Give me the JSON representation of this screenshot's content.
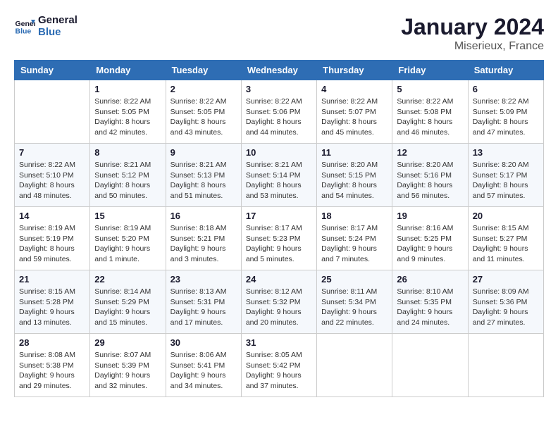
{
  "header": {
    "logo_line1": "General",
    "logo_line2": "Blue",
    "month": "January 2024",
    "location": "Miserieux, France"
  },
  "weekdays": [
    "Sunday",
    "Monday",
    "Tuesday",
    "Wednesday",
    "Thursday",
    "Friday",
    "Saturday"
  ],
  "weeks": [
    [
      {
        "day": "",
        "info": ""
      },
      {
        "day": "1",
        "info": "Sunrise: 8:22 AM\nSunset: 5:05 PM\nDaylight: 8 hours\nand 42 minutes."
      },
      {
        "day": "2",
        "info": "Sunrise: 8:22 AM\nSunset: 5:05 PM\nDaylight: 8 hours\nand 43 minutes."
      },
      {
        "day": "3",
        "info": "Sunrise: 8:22 AM\nSunset: 5:06 PM\nDaylight: 8 hours\nand 44 minutes."
      },
      {
        "day": "4",
        "info": "Sunrise: 8:22 AM\nSunset: 5:07 PM\nDaylight: 8 hours\nand 45 minutes."
      },
      {
        "day": "5",
        "info": "Sunrise: 8:22 AM\nSunset: 5:08 PM\nDaylight: 8 hours\nand 46 minutes."
      },
      {
        "day": "6",
        "info": "Sunrise: 8:22 AM\nSunset: 5:09 PM\nDaylight: 8 hours\nand 47 minutes."
      }
    ],
    [
      {
        "day": "7",
        "info": "Sunrise: 8:22 AM\nSunset: 5:10 PM\nDaylight: 8 hours\nand 48 minutes."
      },
      {
        "day": "8",
        "info": "Sunrise: 8:21 AM\nSunset: 5:12 PM\nDaylight: 8 hours\nand 50 minutes."
      },
      {
        "day": "9",
        "info": "Sunrise: 8:21 AM\nSunset: 5:13 PM\nDaylight: 8 hours\nand 51 minutes."
      },
      {
        "day": "10",
        "info": "Sunrise: 8:21 AM\nSunset: 5:14 PM\nDaylight: 8 hours\nand 53 minutes."
      },
      {
        "day": "11",
        "info": "Sunrise: 8:20 AM\nSunset: 5:15 PM\nDaylight: 8 hours\nand 54 minutes."
      },
      {
        "day": "12",
        "info": "Sunrise: 8:20 AM\nSunset: 5:16 PM\nDaylight: 8 hours\nand 56 minutes."
      },
      {
        "day": "13",
        "info": "Sunrise: 8:20 AM\nSunset: 5:17 PM\nDaylight: 8 hours\nand 57 minutes."
      }
    ],
    [
      {
        "day": "14",
        "info": "Sunrise: 8:19 AM\nSunset: 5:19 PM\nDaylight: 8 hours\nand 59 minutes."
      },
      {
        "day": "15",
        "info": "Sunrise: 8:19 AM\nSunset: 5:20 PM\nDaylight: 9 hours\nand 1 minute."
      },
      {
        "day": "16",
        "info": "Sunrise: 8:18 AM\nSunset: 5:21 PM\nDaylight: 9 hours\nand 3 minutes."
      },
      {
        "day": "17",
        "info": "Sunrise: 8:17 AM\nSunset: 5:23 PM\nDaylight: 9 hours\nand 5 minutes."
      },
      {
        "day": "18",
        "info": "Sunrise: 8:17 AM\nSunset: 5:24 PM\nDaylight: 9 hours\nand 7 minutes."
      },
      {
        "day": "19",
        "info": "Sunrise: 8:16 AM\nSunset: 5:25 PM\nDaylight: 9 hours\nand 9 minutes."
      },
      {
        "day": "20",
        "info": "Sunrise: 8:15 AM\nSunset: 5:27 PM\nDaylight: 9 hours\nand 11 minutes."
      }
    ],
    [
      {
        "day": "21",
        "info": "Sunrise: 8:15 AM\nSunset: 5:28 PM\nDaylight: 9 hours\nand 13 minutes."
      },
      {
        "day": "22",
        "info": "Sunrise: 8:14 AM\nSunset: 5:29 PM\nDaylight: 9 hours\nand 15 minutes."
      },
      {
        "day": "23",
        "info": "Sunrise: 8:13 AM\nSunset: 5:31 PM\nDaylight: 9 hours\nand 17 minutes."
      },
      {
        "day": "24",
        "info": "Sunrise: 8:12 AM\nSunset: 5:32 PM\nDaylight: 9 hours\nand 20 minutes."
      },
      {
        "day": "25",
        "info": "Sunrise: 8:11 AM\nSunset: 5:34 PM\nDaylight: 9 hours\nand 22 minutes."
      },
      {
        "day": "26",
        "info": "Sunrise: 8:10 AM\nSunset: 5:35 PM\nDaylight: 9 hours\nand 24 minutes."
      },
      {
        "day": "27",
        "info": "Sunrise: 8:09 AM\nSunset: 5:36 PM\nDaylight: 9 hours\nand 27 minutes."
      }
    ],
    [
      {
        "day": "28",
        "info": "Sunrise: 8:08 AM\nSunset: 5:38 PM\nDaylight: 9 hours\nand 29 minutes."
      },
      {
        "day": "29",
        "info": "Sunrise: 8:07 AM\nSunset: 5:39 PM\nDaylight: 9 hours\nand 32 minutes."
      },
      {
        "day": "30",
        "info": "Sunrise: 8:06 AM\nSunset: 5:41 PM\nDaylight: 9 hours\nand 34 minutes."
      },
      {
        "day": "31",
        "info": "Sunrise: 8:05 AM\nSunset: 5:42 PM\nDaylight: 9 hours\nand 37 minutes."
      },
      {
        "day": "",
        "info": ""
      },
      {
        "day": "",
        "info": ""
      },
      {
        "day": "",
        "info": ""
      }
    ]
  ]
}
